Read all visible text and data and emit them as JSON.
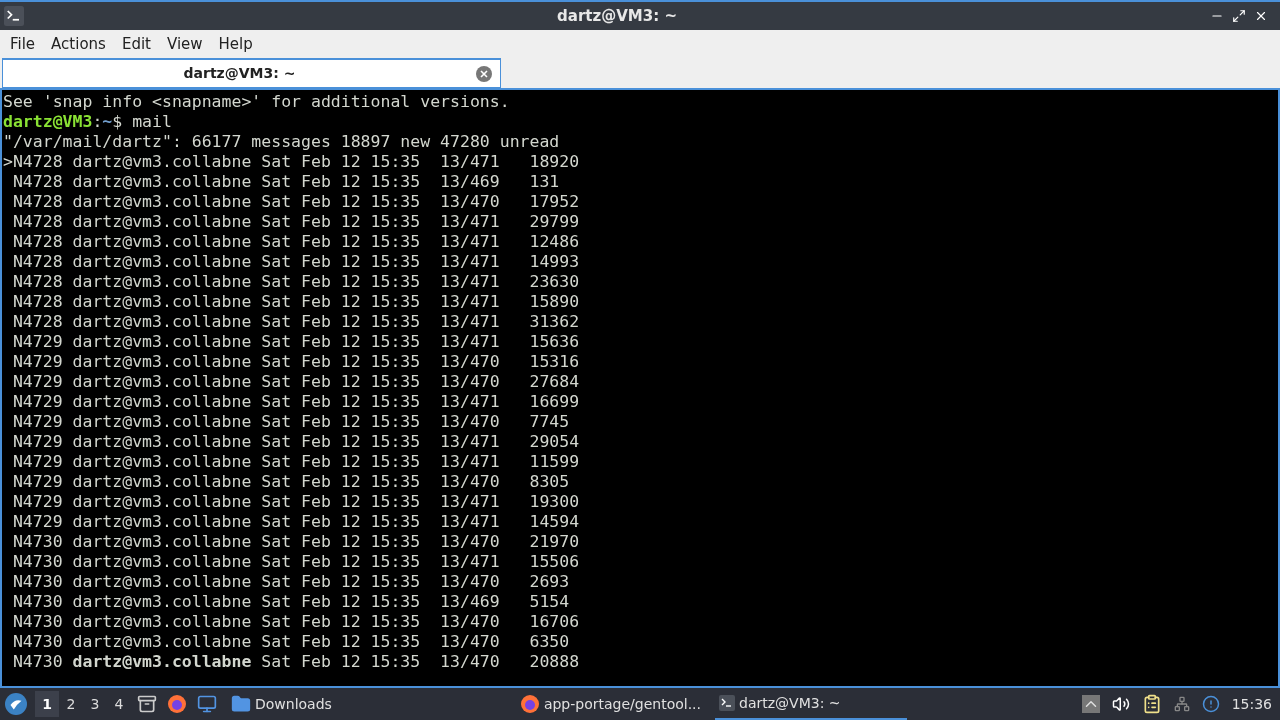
{
  "window": {
    "title": "dartz@VM3: ~"
  },
  "menu": [
    "File",
    "Actions",
    "Edit",
    "View",
    "Help"
  ],
  "tabs": [
    {
      "label": "dartz@VM3: ~",
      "selected": true
    }
  ],
  "terminal": {
    "lines_before": [
      "See 'snap info <snapname>' for additional versions."
    ],
    "prompt": {
      "user_host": "dartz@VM3",
      "separator": ":",
      "path": "~",
      "command": "$ mail"
    },
    "lines": [
      "\"/var/mail/dartz\": 66177 messages 18897 new 47280 unread",
      ">N4728 dartz@vm3.collabne Sat Feb 12 15:35  13/471   18920",
      " N4728 dartz@vm3.collabne Sat Feb 12 15:35  13/469   131",
      " N4728 dartz@vm3.collabne Sat Feb 12 15:35  13/470   17952",
      " N4728 dartz@vm3.collabne Sat Feb 12 15:35  13/471   29799",
      " N4728 dartz@vm3.collabne Sat Feb 12 15:35  13/471   12486",
      " N4728 dartz@vm3.collabne Sat Feb 12 15:35  13/471   14993",
      " N4728 dartz@vm3.collabne Sat Feb 12 15:35  13/471   23630",
      " N4728 dartz@vm3.collabne Sat Feb 12 15:35  13/471   15890",
      " N4728 dartz@vm3.collabne Sat Feb 12 15:35  13/471   31362",
      " N4729 dartz@vm3.collabne Sat Feb 12 15:35  13/471   15636",
      " N4729 dartz@vm3.collabne Sat Feb 12 15:35  13/470   15316",
      " N4729 dartz@vm3.collabne Sat Feb 12 15:35  13/470   27684",
      " N4729 dartz@vm3.collabne Sat Feb 12 15:35  13/471   16699",
      " N4729 dartz@vm3.collabne Sat Feb 12 15:35  13/470   7745",
      " N4729 dartz@vm3.collabne Sat Feb 12 15:35  13/471   29054",
      " N4729 dartz@vm3.collabne Sat Feb 12 15:35  13/471   11599",
      " N4729 dartz@vm3.collabne Sat Feb 12 15:35  13/470   8305",
      " N4729 dartz@vm3.collabne Sat Feb 12 15:35  13/471   19300",
      " N4729 dartz@vm3.collabne Sat Feb 12 15:35  13/471   14594",
      " N4730 dartz@vm3.collabne Sat Feb 12 15:35  13/470   21970",
      " N4730 dartz@vm3.collabne Sat Feb 12 15:35  13/471   15506",
      " N4730 dartz@vm3.collabne Sat Feb 12 15:35  13/470   2693",
      " N4730 dartz@vm3.collabne Sat Feb 12 15:35  13/469   5154",
      " N4730 dartz@vm3.collabne Sat Feb 12 15:35  13/470   16706",
      " N4730 dartz@vm3.collabne Sat Feb 12 15:35  13/470   6350",
      " N4730 **dartz@vm3.collabne** Sat Feb 12 15:35  13/470   20888"
    ]
  },
  "taskbar": {
    "workspaces": [
      {
        "label": "1",
        "selected": true
      },
      {
        "label": "2",
        "selected": false
      },
      {
        "label": "3",
        "selected": false
      },
      {
        "label": "4",
        "selected": false
      }
    ],
    "tasks": [
      {
        "kind": "folder",
        "label": "Downloads",
        "selected": false
      },
      {
        "kind": "browser",
        "label": "app-portage/gentool...",
        "selected": false
      },
      {
        "kind": "terminal",
        "label": "dartz@VM3: ~",
        "selected": true
      }
    ],
    "clock": "15:36"
  }
}
